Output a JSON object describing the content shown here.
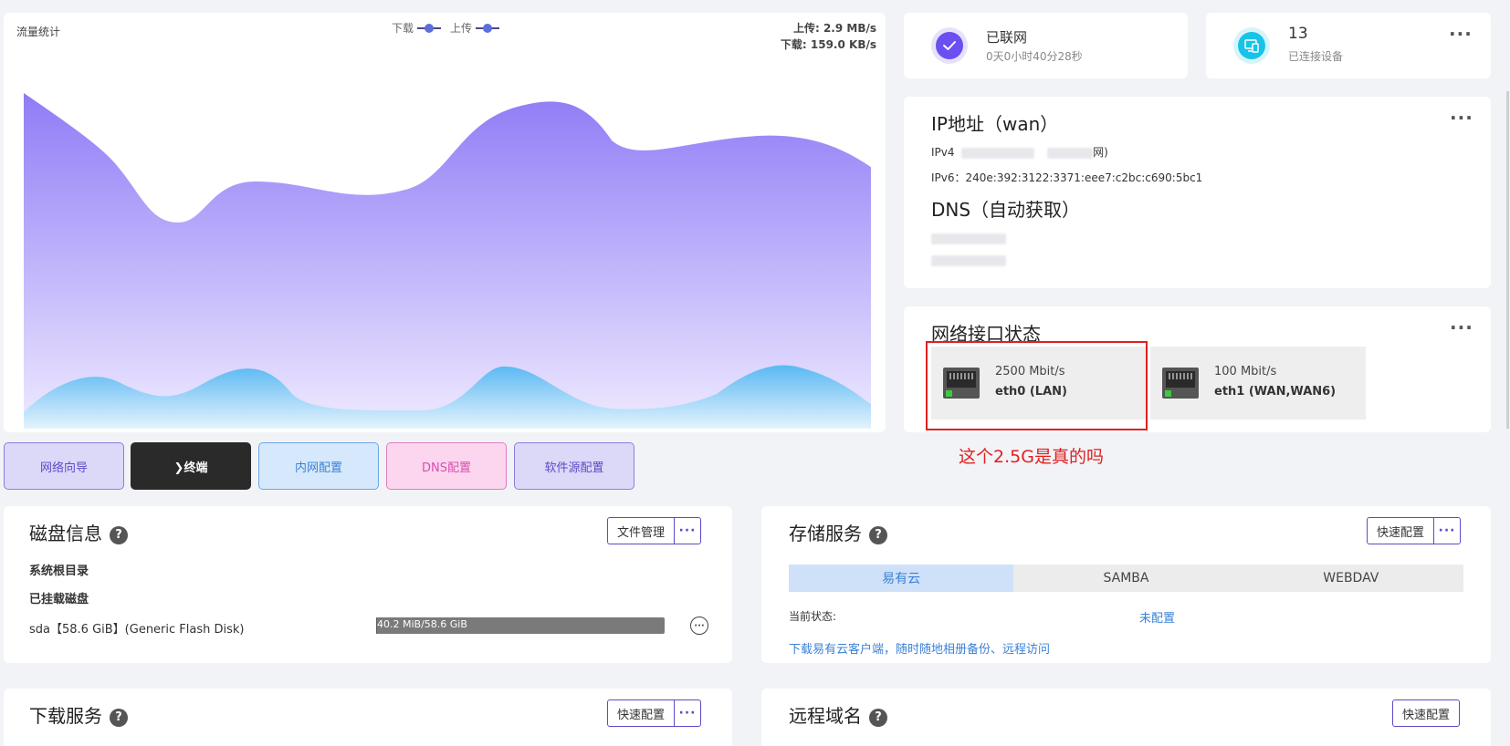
{
  "traffic": {
    "title": "流量统计",
    "legend_download": "下载",
    "legend_upload": "上传",
    "upload_rate": "上传: 2.9 MB/s",
    "download_rate": "下载: 159.0 KB/s"
  },
  "quick_buttons": {
    "network_wizard": "网络向导",
    "terminal": "❯终端",
    "lan_config": "内网配置",
    "dns_config": "DNS配置",
    "source_config": "软件源配置"
  },
  "connection": {
    "status": "已联网",
    "uptime": "0天0小时40分28秒"
  },
  "devices": {
    "count": "13",
    "label": "已连接设备"
  },
  "ip": {
    "title": "IP地址（wan）",
    "ipv4_label": "IPv4",
    "ipv4_suffix": "网)",
    "ipv6": "IPv6：240e:392:3122:3371:eee7:c2bc:c690:5bc1",
    "dns_title": "DNS（自动获取）"
  },
  "interfaces": {
    "title": "网络接口状态",
    "items": [
      {
        "speed": "2500 Mbit/s",
        "name": "eth0 (LAN)"
      },
      {
        "speed": "100 Mbit/s",
        "name": "eth1 (WAN,WAN6)"
      }
    ],
    "annotation": "这个2.5G是真的吗"
  },
  "disk": {
    "title": "磁盘信息",
    "file_manager": "文件管理",
    "root_dir": "系统根目录",
    "mounted": "已挂载磁盘",
    "disk_name": "sda【58.6 GiB】(Generic Flash Disk)",
    "usage_text": "40.2 MiB/58.6 GiB",
    "usage_fraction": 0.0007
  },
  "storage": {
    "title": "存储服务",
    "quick_config": "快速配置",
    "tabs": [
      "易有云",
      "SAMBA",
      "WEBDAV"
    ],
    "state_label": "当前状态:",
    "state_value": "未配置",
    "download_link": "下载易有云客户端，随时随地相册备份、远程访问"
  },
  "download": {
    "title": "下载服务",
    "quick_config": "快速配置"
  },
  "remote": {
    "title": "远程域名",
    "quick_config": "快速配置"
  },
  "colors": {
    "purple": "#6b4ff0",
    "cyan": "#17c3e8",
    "annotation_red": "#e02020",
    "link_blue": "#3b82d6"
  }
}
